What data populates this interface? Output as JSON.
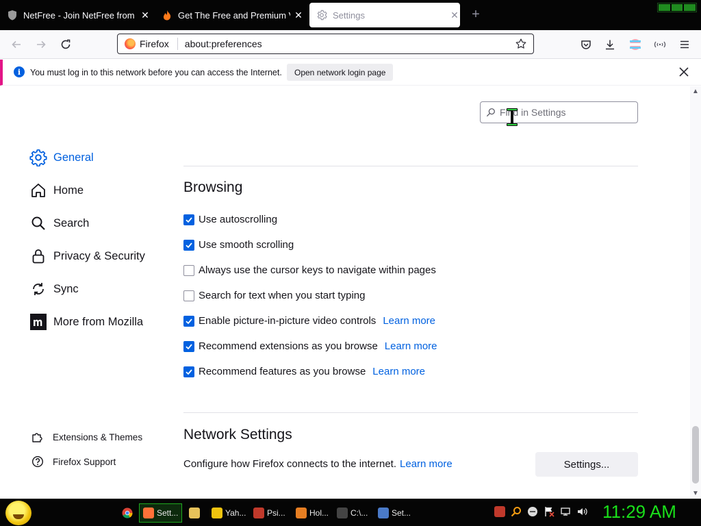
{
  "tabs": [
    {
      "title": "NetFree - Join NetFree from our",
      "icon": "shield-icon"
    },
    {
      "title": "Get The Free and Premium VPN",
      "icon": "flame-icon"
    },
    {
      "title": "Settings",
      "icon": "gear-icon",
      "active": true
    }
  ],
  "urlbar": {
    "identity": "Firefox",
    "url": "about:preferences"
  },
  "notification": {
    "message": "You must log in to this network before you can access the Internet.",
    "button": "Open network login page"
  },
  "search": {
    "placeholder": "Find in Settings"
  },
  "sidebar": {
    "items": [
      {
        "label": "General",
        "icon": "gear-icon",
        "selected": true
      },
      {
        "label": "Home",
        "icon": "home-icon"
      },
      {
        "label": "Search",
        "icon": "search-icon"
      },
      {
        "label": "Privacy & Security",
        "icon": "lock-icon"
      },
      {
        "label": "Sync",
        "icon": "sync-icon"
      },
      {
        "label": "More from Mozilla",
        "icon": "mozilla-icon"
      }
    ],
    "footer": [
      {
        "label": "Extensions & Themes",
        "icon": "puzzle-icon"
      },
      {
        "label": "Firefox Support",
        "icon": "help-icon"
      }
    ]
  },
  "browsing": {
    "heading": "Browsing",
    "options": [
      {
        "label": "Use autoscrolling",
        "checked": true,
        "link": ""
      },
      {
        "label": "Use smooth scrolling",
        "checked": true,
        "link": ""
      },
      {
        "label": "Always use the cursor keys to navigate within pages",
        "checked": false,
        "link": ""
      },
      {
        "label": "Search for text when you start typing",
        "checked": false,
        "link": ""
      },
      {
        "label": "Enable picture-in-picture video controls",
        "checked": true,
        "link": "Learn more"
      },
      {
        "label": "Recommend extensions as you browse",
        "checked": true,
        "link": "Learn more"
      },
      {
        "label": "Recommend features as you browse",
        "checked": true,
        "link": "Learn more"
      }
    ]
  },
  "network": {
    "heading": "Network Settings",
    "description": "Configure how Firefox connects to the internet.",
    "link": "Learn more",
    "button": "Settings..."
  },
  "taskbar": {
    "items": [
      {
        "label": "Sett...",
        "active": true,
        "color": "#ff7139"
      },
      {
        "label": "",
        "color": "#e6c25a"
      },
      {
        "label": "Yah...",
        "color": "#f1c40f"
      },
      {
        "label": "Psi...",
        "color": "#c0392b"
      },
      {
        "label": "Hol...",
        "color": "#e67e22"
      },
      {
        "label": "C:\\...",
        "color": "#444444"
      },
      {
        "label": "Set...",
        "color": "#4a7ac8"
      }
    ],
    "clock": "11:29 AM"
  },
  "colors": {
    "accent": "#0060df",
    "notification_stripe": "#e31587",
    "clock": "#1adf1a"
  }
}
